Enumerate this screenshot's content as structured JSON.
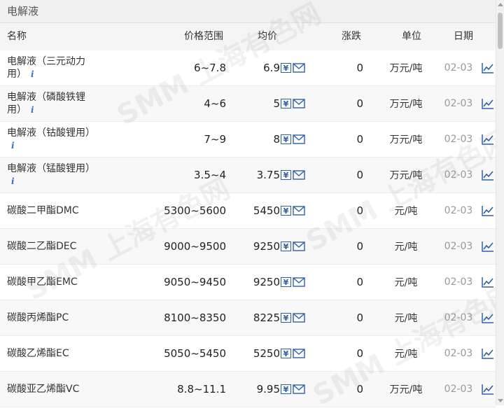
{
  "section": {
    "title": "电解液"
  },
  "columns": {
    "name": "名称",
    "range": "价格范围",
    "avg": "均价",
    "change": "涨跌",
    "unit": "单位",
    "date": "日期"
  },
  "rows": [
    {
      "name_line1": "电解液（三元动力",
      "name_line2": "用）",
      "info": "i",
      "range": "6~7.8",
      "avg": "6.9",
      "change": "0",
      "unit": "万元/吨",
      "date": "02-03"
    },
    {
      "name_line1": "电解液（磷酸铁锂",
      "name_line2": "用）",
      "info": "i",
      "range": "4~6",
      "avg": "5",
      "change": "0",
      "unit": "万元/吨",
      "date": "02-03"
    },
    {
      "name_line1": "电解液（钴酸锂用）",
      "name_line2": "",
      "info": "i",
      "range": "7~9",
      "avg": "8",
      "change": "0",
      "unit": "万元/吨",
      "date": "02-03"
    },
    {
      "name_line1": "电解液（锰酸锂用）",
      "name_line2": "",
      "info": "i",
      "range": "3.5~4",
      "avg": "3.75",
      "change": "0",
      "unit": "万元/吨",
      "date": "02-03"
    },
    {
      "name_line1": "碳酸二甲酯DMC",
      "name_line2": "",
      "info": "",
      "range": "5300~5600",
      "avg": "5450",
      "change": "0",
      "unit": "元/吨",
      "date": "02-03"
    },
    {
      "name_line1": "碳酸二乙酯DEC",
      "name_line2": "",
      "info": "",
      "range": "9000~9500",
      "avg": "9250",
      "change": "0",
      "unit": "元/吨",
      "date": "02-03"
    },
    {
      "name_line1": "碳酸甲乙酯EMC",
      "name_line2": "",
      "info": "",
      "range": "9050~9450",
      "avg": "9250",
      "change": "0",
      "unit": "元/吨",
      "date": "02-03"
    },
    {
      "name_line1": "碳酸丙烯酯PC",
      "name_line2": "",
      "info": "",
      "range": "8100~8350",
      "avg": "8225",
      "change": "0",
      "unit": "元/吨",
      "date": "02-03"
    },
    {
      "name_line1": "碳酸乙烯酯EC",
      "name_line2": "",
      "info": "",
      "range": "5050~5450",
      "avg": "5250",
      "change": "0",
      "unit": "元/吨",
      "date": "02-03"
    },
    {
      "name_line1": "碳酸亚乙烯酯VC",
      "name_line2": "",
      "info": "",
      "range": "8.8~11.1",
      "avg": "9.95",
      "change": "0",
      "unit": "万元/吨",
      "date": "02-03"
    }
  ],
  "icons": {
    "yen": "¥",
    "mail": "mail-icon",
    "chart": "trend-chart-icon",
    "info": "info-icon"
  },
  "colors": {
    "accent": "#2f5fa8",
    "date": "#999999",
    "header_bg": "#f5f5f5",
    "row_alt": "#f8f8f8"
  },
  "watermark": {
    "text": "SMM 上海有色网"
  }
}
